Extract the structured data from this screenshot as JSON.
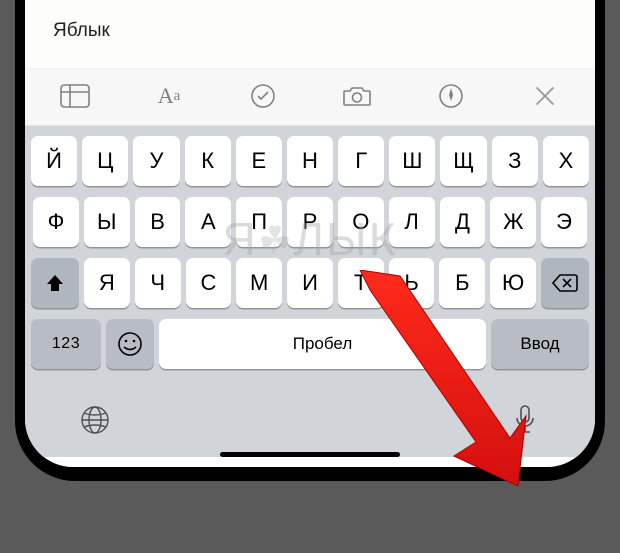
{
  "text_area": {
    "content": "Яблык"
  },
  "toolbar": {
    "icons": [
      "table",
      "textformat",
      "checkmark-circle",
      "camera",
      "markup",
      "close"
    ]
  },
  "keyboard": {
    "row1": [
      "Й",
      "Ц",
      "У",
      "К",
      "Е",
      "Н",
      "Г",
      "Ш",
      "Щ",
      "З",
      "Х"
    ],
    "row2": [
      "Ф",
      "Ы",
      "В",
      "А",
      "П",
      "Р",
      "О",
      "Л",
      "Д",
      "Ж",
      "Э"
    ],
    "row3": [
      "Я",
      "Ч",
      "С",
      "М",
      "И",
      "Т",
      "Ь",
      "Б",
      "Ю"
    ],
    "numbers_label": "123",
    "space_label": "Пробел",
    "return_label": "Ввод"
  },
  "watermark": "ЯБЛЫК"
}
